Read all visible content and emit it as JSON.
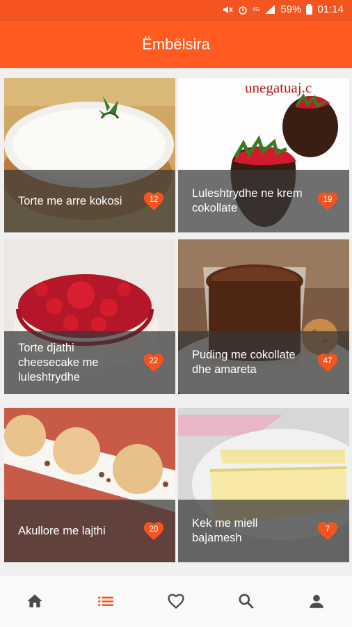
{
  "status_bar": {
    "network": "4G",
    "battery": "59%",
    "time": "01:14"
  },
  "app_bar": {
    "title": "Ëmbëlsira"
  },
  "recipes": [
    {
      "title": "Torte me arre kokosi",
      "likes": "12"
    },
    {
      "title": "Luleshtrydhe ne krem cokollate",
      "likes": "19",
      "watermark": "unegatuaj.c"
    },
    {
      "title": "Torte djathi cheesecake me luleshtrydhe",
      "likes": "22"
    },
    {
      "title": "Puding me cokollate dhe amareta",
      "likes": "47"
    },
    {
      "title": "Akullore me lajthi",
      "likes": "20"
    },
    {
      "title": "Kek me miell bajamesh",
      "likes": "7"
    }
  ],
  "bottom_nav": {
    "items": [
      {
        "icon": "home-icon",
        "active": false
      },
      {
        "icon": "list-icon",
        "active": true
      },
      {
        "icon": "heart-outline-icon",
        "active": false
      },
      {
        "icon": "search-icon",
        "active": false
      },
      {
        "icon": "person-icon",
        "active": false
      }
    ],
    "active_color": "#f4541f",
    "inactive_color": "#4a4a4a"
  },
  "colors": {
    "primary": "#ff5b20",
    "status": "#f4541f",
    "badge": "#f4541f"
  }
}
